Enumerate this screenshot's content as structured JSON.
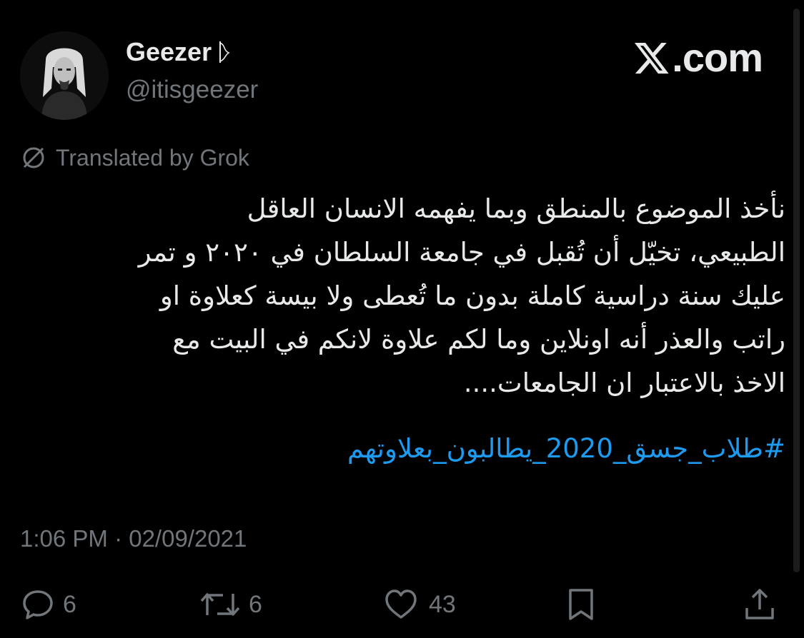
{
  "author": {
    "display_name": "Geezer",
    "handle": "@itisgeezer",
    "avatar": "profile-photo"
  },
  "brand": {
    "logo": "x-logo",
    "label": ".com"
  },
  "translation": {
    "icon": "translate-off-icon",
    "label": "Translated by Grok"
  },
  "tweet": {
    "lines": [
      "نأخذ الموضوع بالمنطق وبما يفهمه الانسان العاقل",
      "الطبيعي، تخيّل أن تُقبل في جامعة السلطان في ٢٠٢٠ و تمر",
      "عليك سنة دراسية كاملة بدون ما تُعطى ولا بيسة كعلاوة او",
      "راتب والعذر أنه اونلاين وما لكم علاوة لانكم في البيت مع",
      "الاخذ بالاعتبار ان الجامعات...."
    ],
    "hashtag": "#طلاب_جسق_2020_يطالبون_بعلاوتهم",
    "timestamp": "1:06 PM · 02/09/2021"
  },
  "actions": {
    "reply": {
      "icon": "reply-icon",
      "count": "6"
    },
    "repost": {
      "icon": "repost-icon",
      "count": "6"
    },
    "like": {
      "icon": "heart-icon",
      "count": "43"
    },
    "bookmark": {
      "icon": "bookmark-icon"
    },
    "share": {
      "icon": "share-icon"
    }
  },
  "colors": {
    "background": "#000000",
    "primary_text": "#e7e9ea",
    "secondary_text": "#71767b",
    "link": "#1d9bf0"
  }
}
